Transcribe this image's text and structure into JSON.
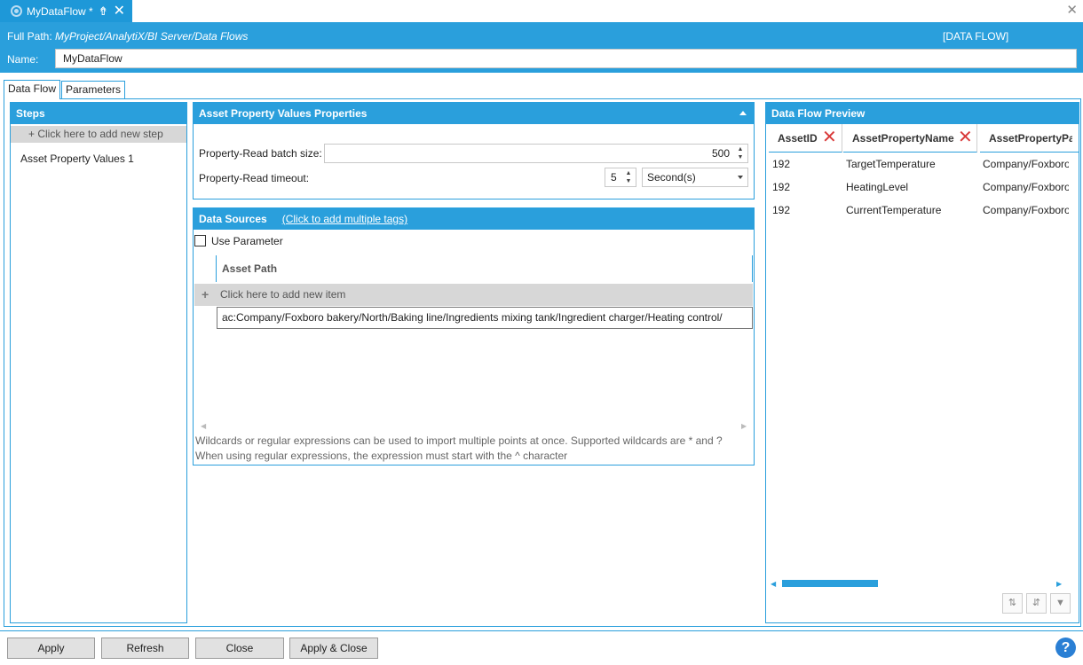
{
  "document_tab": {
    "title": "MyDataFlow *"
  },
  "header": {
    "full_path_label": "Full Path:",
    "full_path_value": "MyProject/AnalytiX/BI Server/Data Flows",
    "type_tag": "[DATA FLOW]",
    "name_label": "Name:",
    "name_value": "MyDataFlow"
  },
  "tabs": [
    {
      "label": "Data Flow"
    },
    {
      "label": "Parameters"
    }
  ],
  "steps": {
    "title": "Steps",
    "add_label": "+  Click here to add new step",
    "items": [
      {
        "label": "Asset Property Values  1"
      }
    ]
  },
  "properties": {
    "title": "Asset Property Values Properties",
    "batch_label": "Property-Read batch size:",
    "batch_value": "500",
    "timeout_label": "Property-Read timeout:",
    "timeout_value": "5",
    "timeout_unit": "Second(s)"
  },
  "data_sources": {
    "title": "Data Sources",
    "link": "(Click to add multiple tags)",
    "use_parameter_label": "Use Parameter",
    "column_header": "Asset Path",
    "add_item_label": "Click here to add new item",
    "rows": [
      "ac:Company/Foxboro bakery/North/Baking line/Ingredients mixing tank/Ingredient charger/Heating control/"
    ],
    "hint": "Wildcards or regular expressions can be used to import multiple points at once. Supported wildcards are * and ? When using regular expressions, the expression must start with the ^ character"
  },
  "preview": {
    "title": "Data Flow Preview",
    "columns": [
      "AssetID",
      "AssetPropertyName",
      "AssetPropertyPath"
    ],
    "rows": [
      [
        "192",
        "TargetTemperature",
        "Company/Foxboro"
      ],
      [
        "192",
        "HeatingLevel",
        "Company/Foxboro"
      ],
      [
        "192",
        "CurrentTemperature",
        "Company/Foxboro"
      ]
    ]
  },
  "buttons": {
    "apply": "Apply",
    "refresh": "Refresh",
    "close": "Close",
    "apply_close": "Apply & Close",
    "help": "?"
  },
  "colors": {
    "accent": "#2a9fdc",
    "remove_red": "#d93a3a",
    "help_blue": "#2a7fd4"
  }
}
